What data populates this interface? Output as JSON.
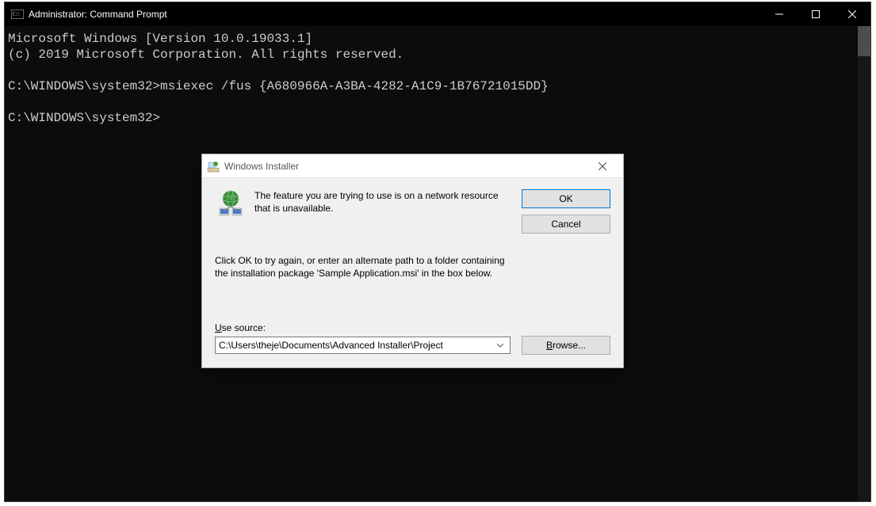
{
  "cmd": {
    "title": "Administrator: Command Prompt",
    "lines": {
      "l1": "Microsoft Windows [Version 10.0.19033.1]",
      "l2": "(c) 2019 Microsoft Corporation. All rights reserved.",
      "l3": "",
      "l4": "C:\\WINDOWS\\system32>msiexec /fus {A680966A-A3BA-4282-A1C9-1B76721015DD}",
      "l5": "",
      "l6": "C:\\WINDOWS\\system32>"
    }
  },
  "dialog": {
    "title": "Windows Installer",
    "message": "The feature you are trying to use is on a network resource that is unavailable.",
    "ok_label": "OK",
    "cancel_label": "Cancel",
    "instruction": "Click OK to try again, or enter an alternate path to a folder containing the installation package 'Sample Application.msi' in the box below.",
    "use_source_label": "Use source:",
    "source_value": "C:\\Users\\theje\\Documents\\Advanced Installer\\Project",
    "browse_label": "Browse..."
  }
}
